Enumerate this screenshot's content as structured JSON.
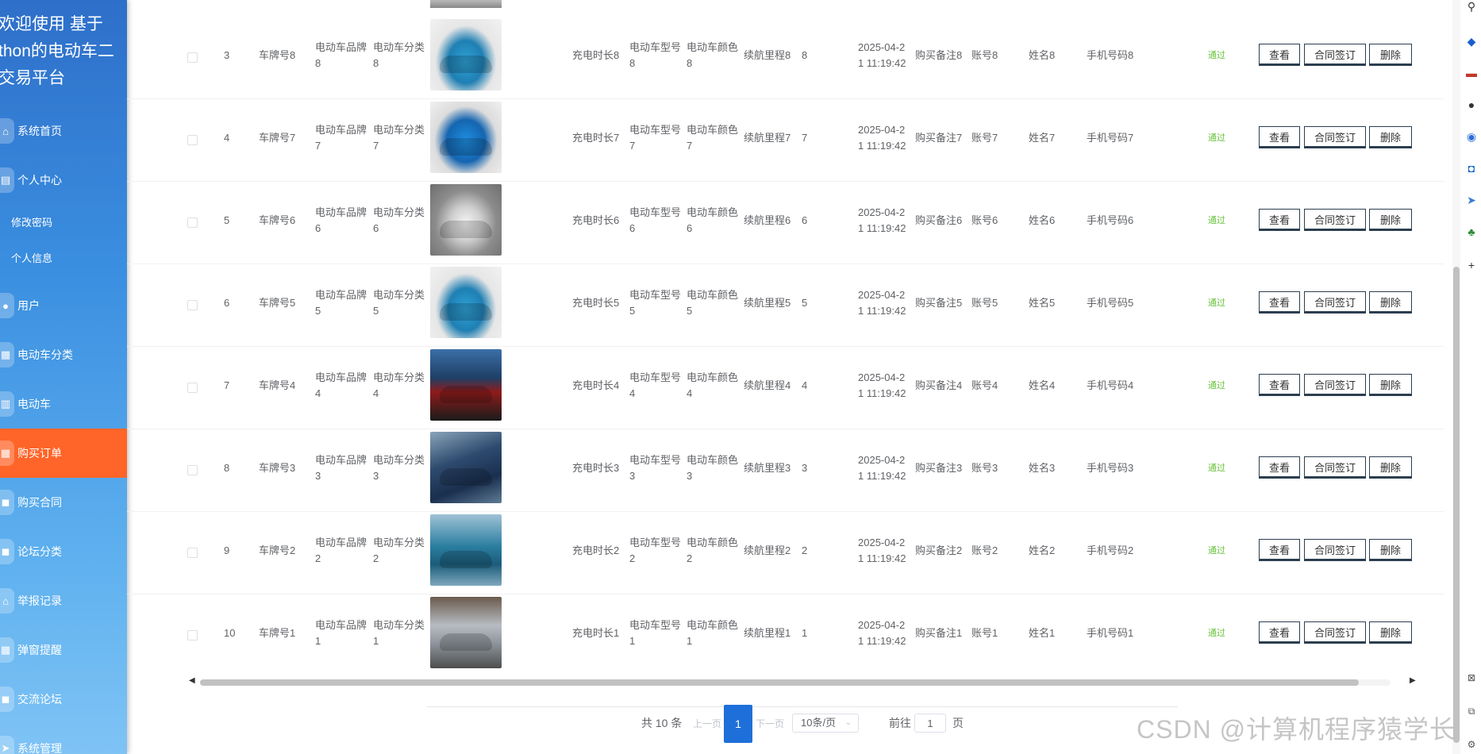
{
  "sidebar": {
    "brand": [
      "欢迎使用 基于",
      "thon的电动车二",
      "交易平台"
    ],
    "items": [
      {
        "label": "系统首页",
        "icon": "home-icon"
      },
      {
        "label": "个人中心",
        "icon": "document-icon"
      },
      {
        "label": "修改密码",
        "sub": true
      },
      {
        "label": "个人信息",
        "sub": true
      },
      {
        "label": "用户",
        "icon": "user-icon"
      },
      {
        "label": "电动车分类",
        "icon": "grid-icon"
      },
      {
        "label": "电动车",
        "icon": "chart-icon"
      },
      {
        "label": "购买订单",
        "icon": "grid-icon",
        "active": true
      },
      {
        "label": "购买合同",
        "icon": "chat-icon"
      },
      {
        "label": "论坛分类",
        "icon": "chat-icon"
      },
      {
        "label": "举报记录",
        "icon": "home-icon"
      },
      {
        "label": "弹窗提醒",
        "icon": "grid-icon"
      },
      {
        "label": "交流论坛",
        "icon": "chat-icon"
      },
      {
        "label": "系统管理",
        "icon": "send-icon"
      }
    ]
  },
  "table": {
    "rows": [
      {
        "index": "3",
        "plate": "车牌号8",
        "brand": [
          "电动车品牌",
          "8"
        ],
        "category": [
          "电动车分类",
          "8"
        ],
        "charge": "充电时长8",
        "model": [
          "电动车型号",
          "8"
        ],
        "color": [
          "电动车颜色",
          "8"
        ],
        "range": "续航里程8",
        "qty": "8",
        "time": [
          "2025-04-2",
          "1 11:19:42"
        ],
        "note": "购买备注8",
        "account": "账号8",
        "name": "姓名8",
        "phone": "手机号码8",
        "status": "通过",
        "img": "teal"
      },
      {
        "index": "4",
        "plate": "车牌号7",
        "brand": [
          "电动车品牌",
          "7"
        ],
        "category": [
          "电动车分类",
          "7"
        ],
        "charge": "充电时长7",
        "model": [
          "电动车型号",
          "7"
        ],
        "color": [
          "电动车颜色",
          "7"
        ],
        "range": "续航里程7",
        "qty": "7",
        "time": [
          "2025-04-2",
          "1 11:19:42"
        ],
        "note": "购买备注7",
        "account": "账号7",
        "name": "姓名7",
        "phone": "手机号码7",
        "status": "通过",
        "img": "blue"
      },
      {
        "index": "5",
        "plate": "车牌号6",
        "brand": [
          "电动车品牌",
          "6"
        ],
        "category": [
          "电动车分类",
          "6"
        ],
        "charge": "充电时长6",
        "model": [
          "电动车型号",
          "6"
        ],
        "color": [
          "电动车颜色",
          "6"
        ],
        "range": "续航里程6",
        "qty": "6",
        "time": [
          "2025-04-2",
          "1 11:19:42"
        ],
        "note": "购买备注6",
        "account": "账号6",
        "name": "姓名6",
        "phone": "手机号码6",
        "status": "通过",
        "img": "white"
      },
      {
        "index": "6",
        "plate": "车牌号5",
        "brand": [
          "电动车品牌",
          "5"
        ],
        "category": [
          "电动车分类",
          "5"
        ],
        "charge": "充电时长5",
        "model": [
          "电动车型号",
          "5"
        ],
        "color": [
          "电动车颜色",
          "5"
        ],
        "range": "续航里程5",
        "qty": "5",
        "time": [
          "2025-04-2",
          "1 11:19:42"
        ],
        "note": "购买备注5",
        "account": "账号5",
        "name": "姓名5",
        "phone": "手机号码5",
        "status": "通过",
        "img": "teal"
      },
      {
        "index": "7",
        "plate": "车牌号4",
        "brand": [
          "电动车品牌",
          "4"
        ],
        "category": [
          "电动车分类",
          "4"
        ],
        "charge": "充电时长4",
        "model": [
          "电动车型号",
          "4"
        ],
        "color": [
          "电动车颜色",
          "4"
        ],
        "range": "续航里程4",
        "qty": "4",
        "time": [
          "2025-04-2",
          "1 11:19:42"
        ],
        "note": "购买备注4",
        "account": "账号4",
        "name": "姓名4",
        "phone": "手机号码4",
        "status": "通过",
        "img": "red"
      },
      {
        "index": "8",
        "plate": "车牌号3",
        "brand": [
          "电动车品牌",
          "3"
        ],
        "category": [
          "电动车分类",
          "3"
        ],
        "charge": "充电时长3",
        "model": [
          "电动车型号",
          "3"
        ],
        "color": [
          "电动车颜色",
          "3"
        ],
        "range": "续航里程3",
        "qty": "3",
        "time": [
          "2025-04-2",
          "1 11:19:42"
        ],
        "note": "购买备注3",
        "account": "账号3",
        "name": "姓名3",
        "phone": "手机号码3",
        "status": "通过",
        "img": "navy"
      },
      {
        "index": "9",
        "plate": "车牌号2",
        "brand": [
          "电动车品牌",
          "2"
        ],
        "category": [
          "电动车分类",
          "2"
        ],
        "charge": "充电时长2",
        "model": [
          "电动车型号",
          "2"
        ],
        "color": [
          "电动车颜色",
          "2"
        ],
        "range": "续航里程2",
        "qty": "2",
        "time": [
          "2025-04-2",
          "1 11:19:42"
        ],
        "note": "购买备注2",
        "account": "账号2",
        "name": "姓名2",
        "phone": "手机号码2",
        "status": "通过",
        "img": "cyan"
      },
      {
        "index": "10",
        "plate": "车牌号1",
        "brand": [
          "电动车品牌",
          "1"
        ],
        "category": [
          "电动车分类",
          "1"
        ],
        "charge": "充电时长1",
        "model": [
          "电动车型号",
          "1"
        ],
        "color": [
          "电动车颜色",
          "1"
        ],
        "range": "续航里程1",
        "qty": "1",
        "time": [
          "2025-04-2",
          "1 11:19:42"
        ],
        "note": "购买备注1",
        "account": "账号1",
        "name": "姓名1",
        "phone": "手机号码1",
        "status": "通过",
        "img": "silver"
      }
    ],
    "actions": {
      "view": "查看",
      "contract": "合同签订",
      "delete": "删除"
    }
  },
  "pagination": {
    "total": "共 10 条",
    "prev": "上一页",
    "current": "1",
    "next": "下一页",
    "page_size": "10条/页",
    "goto_prefix": "前往",
    "goto_value": "1",
    "goto_suffix": "页"
  },
  "watermark": "CSDN @计算机程序猿学长",
  "colors": {
    "accent": "#ff6428",
    "primary": "#1e6fd9",
    "status_ok": "#67c23a",
    "sidebar": "#3a8ee0"
  }
}
